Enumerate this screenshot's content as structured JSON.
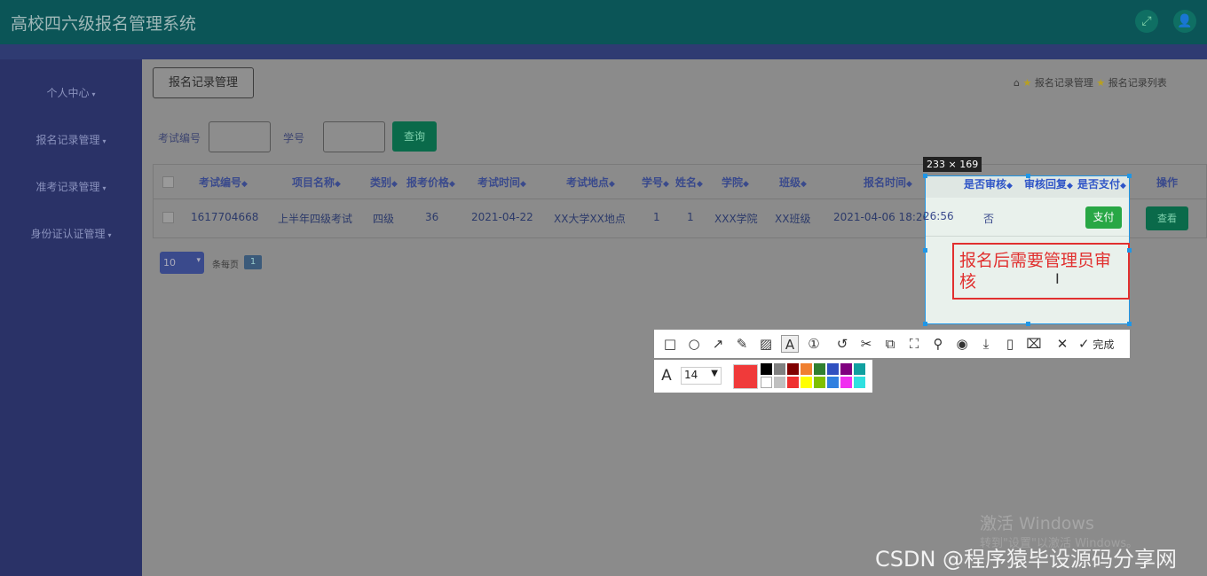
{
  "header": {
    "title": "高校四六级报名管理系统",
    "icons": [
      "fullscreen-icon",
      "user-icon"
    ]
  },
  "sidebar": {
    "items": [
      {
        "label": "个人中心"
      },
      {
        "label": "报名记录管理"
      },
      {
        "label": "准考记录管理"
      },
      {
        "label": "身份证认证管理"
      }
    ]
  },
  "main": {
    "page_button": "报名记录管理",
    "breadcrumb": [
      "报名记录管理",
      "报名记录列表"
    ],
    "search": {
      "exam_no_label": "考试编号",
      "student_no_label": "学号",
      "query_button": "查询"
    },
    "table": {
      "headers": [
        "考试编号",
        "项目名称",
        "类别",
        "报考价格",
        "考试时间",
        "考试地点",
        "学号",
        "姓名",
        "学院",
        "班级",
        "报名时间",
        "是否审核",
        "审核回复",
        "是否支付",
        "操作"
      ],
      "row": {
        "exam_no": "1617704668",
        "project": "上半年四级考试",
        "category": "四级",
        "price": "36",
        "exam_time": "2021-04-22",
        "location": "XX大学XX地点",
        "student_no": "1",
        "name": "1",
        "college": "XXX学院",
        "class": "XX班级",
        "signup_time": "2021-04-06 18:26:56",
        "reviewed": "否",
        "pay_button": "支付",
        "view_button": "查看"
      }
    },
    "pagination": {
      "page_size": "10",
      "per_page_text": "条每页",
      "current_page": "1"
    }
  },
  "screenshot_tool": {
    "size_label": "233 × 169",
    "annotation_text": "报名后需要管理员审核",
    "done_label": "完成",
    "font_size": "14",
    "active_color": "#f03a3a",
    "palette": [
      "#000000",
      "#808080",
      "#800000",
      "#f08030",
      "#308030",
      "#3050c0",
      "#800080",
      "#10a0a0",
      "#ffffff",
      "#c0c0c0",
      "#f03030",
      "#ffff00",
      "#80c000",
      "#3080e0",
      "#f030f0",
      "#30e0e0"
    ]
  },
  "watermark": {
    "activate": "激活 Windows",
    "activate_hint": "转到\"设置\"以激活 Windows。",
    "csdn": "CSDN @程序猿毕设源码分享网"
  }
}
